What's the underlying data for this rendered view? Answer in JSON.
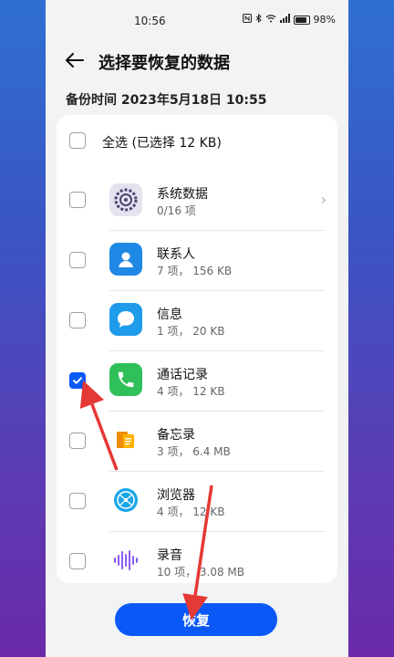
{
  "status_bar": {
    "time": "10:56",
    "battery": "98%",
    "icons": [
      "nfc-icon",
      "bluetooth-icon",
      "wifi-icon",
      "signal-icon",
      "battery-icon"
    ]
  },
  "header": {
    "title": "选择要恢复的数据",
    "back_icon": "arrow-left-icon"
  },
  "backup_time": "备份时间 2023年5月18日 10:55",
  "select_all": {
    "label": "全选 (已选择 12 KB)",
    "checked": false
  },
  "items": [
    {
      "name": "系统数据",
      "sub": "0/16 项",
      "icon": "settings-gear-icon",
      "checked": false,
      "has_chevron": true
    },
    {
      "name": "联系人",
      "sub": "7 项， 156 KB",
      "icon": "contacts-icon",
      "checked": false,
      "has_chevron": false
    },
    {
      "name": "信息",
      "sub": "1 项， 20 KB",
      "icon": "messages-icon",
      "checked": false,
      "has_chevron": false
    },
    {
      "name": "通话记录",
      "sub": "4 项， 12 KB",
      "icon": "phone-icon",
      "checked": true,
      "has_chevron": false
    },
    {
      "name": "备忘录",
      "sub": "3 项， 6.4 MB",
      "icon": "notes-icon",
      "checked": false,
      "has_chevron": false
    },
    {
      "name": "浏览器",
      "sub": "4 项， 12 KB",
      "icon": "browser-icon",
      "checked": false,
      "has_chevron": false
    },
    {
      "name": "录音",
      "sub": "10 项， 3.08 MB",
      "icon": "recorder-icon",
      "checked": false,
      "has_chevron": false
    }
  ],
  "restore_button": "恢复",
  "colors": {
    "accent": "#0a59f7",
    "annotation": "#e53935"
  }
}
